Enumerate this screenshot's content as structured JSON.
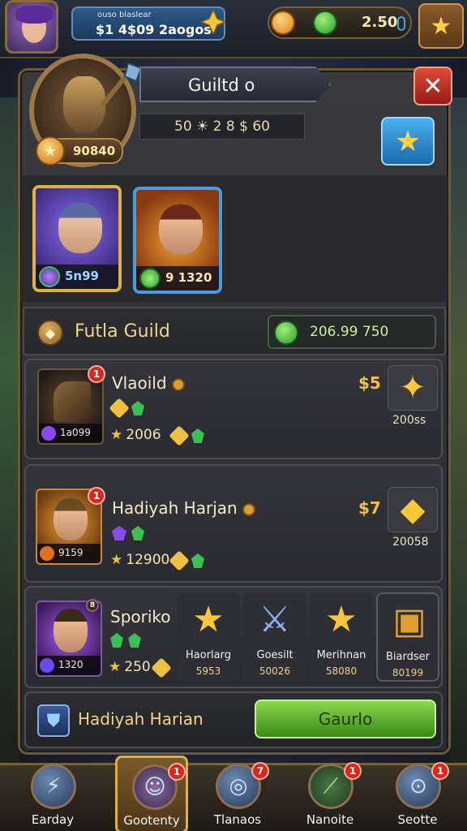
{
  "topbar": {
    "player_subtitle": "ouso blaslear",
    "player_name": "$1 4$09 2aogos",
    "currency_value": "2.50"
  },
  "panel": {
    "title": "Guiltd o",
    "stats": "50 ☀ 2 8 $ 60",
    "guild_level": "90840"
  },
  "heroes": [
    {
      "value": "5n99"
    },
    {
      "value": "9 1320"
    }
  ],
  "guild": {
    "name": "Futla Guild",
    "gold": "206.99 750"
  },
  "members": [
    {
      "name": "Vlaoild",
      "portrait_value": "1a099",
      "stat": "2006",
      "price": "$5",
      "reward_value": "200ss",
      "badge": "1"
    },
    {
      "name": "Hadiyah Harjan",
      "portrait_value": "9159",
      "stat": "12900",
      "price": "$7",
      "reward_value": "20058",
      "badge": "1"
    },
    {
      "name": "Sporiko",
      "portrait_value": "1320",
      "stat": "250",
      "price": "",
      "badge": "8"
    }
  ],
  "shop": [
    {
      "label": "Haorlarg",
      "price": "5953",
      "icon": "star-icon"
    },
    {
      "label": "Goesilt",
      "price": "50026",
      "icon": "sword-icon"
    },
    {
      "label": "Merihnan",
      "price": "58080",
      "icon": "star-icon"
    },
    {
      "label": "Biardser",
      "price": "80199",
      "icon": "chest-icon"
    }
  ],
  "footer": {
    "name": "Hadiyah Harian",
    "button": "Gaurlo"
  },
  "nav": [
    {
      "label": "Earday",
      "badge": ""
    },
    {
      "label": "Gootenty",
      "badge": "1"
    },
    {
      "label": "Tlanaos",
      "badge": "7"
    },
    {
      "label": "Nanoite",
      "badge": "1"
    },
    {
      "label": "Seotte",
      "badge": "1"
    }
  ],
  "colors": {
    "accent_gold": "#f0c040",
    "panel_border": "#6a5a3a",
    "close_red": "#d8281e",
    "action_green": "#3a8a1a",
    "fav_blue": "#1a6ab0"
  }
}
